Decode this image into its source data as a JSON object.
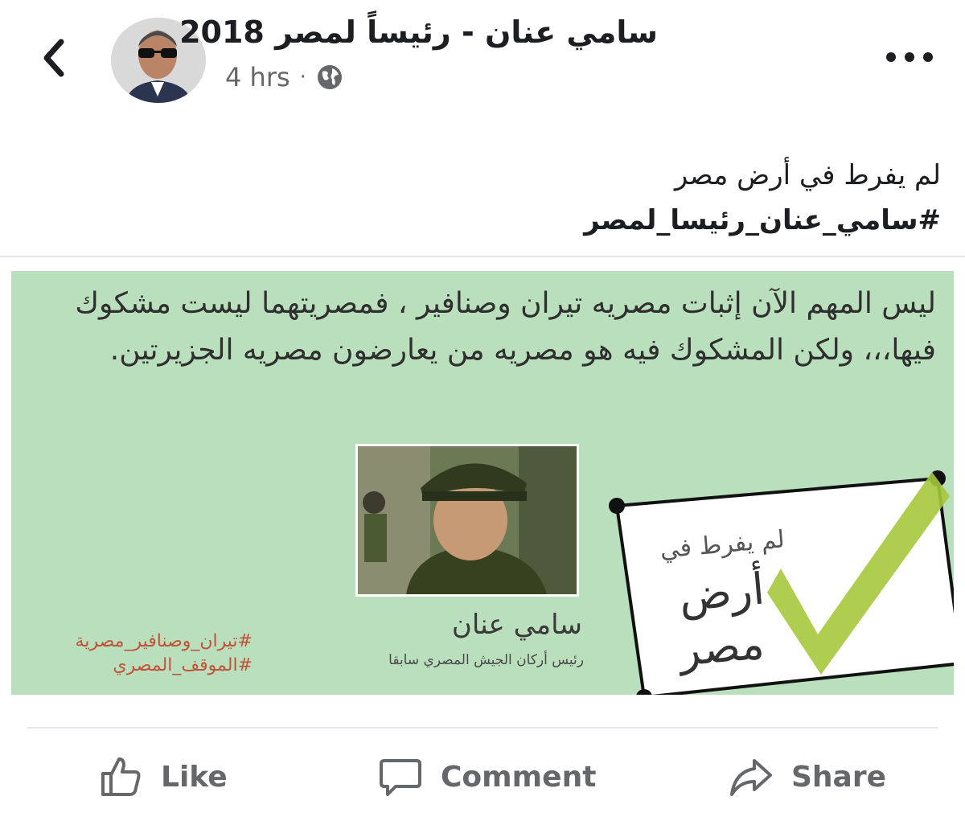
{
  "post": {
    "page_name": "سامي عنان - رئيساً لمصر 2018",
    "time": "4 hrs",
    "separator": "·",
    "caption_line1": "لم يفرط في أرض مصر",
    "caption_hashtag": "#سامي_عنان_رئيسا_لمصر"
  },
  "image": {
    "quote_line1": "ليس المهم الآن إثبات مصريه تيران وصنافير ، فمصريتهما ليست مشكوك",
    "quote_line2": "فيها،،، ولكن المشكوك فيه هو مصريه من يعارضون مصريه الجزيرتين.",
    "person_name": "سامي عنان",
    "person_title": "رئيس أركان الجيش المصري سابقا",
    "tag1": "#تيران_وصنافير_مصرية",
    "tag2": "#الموقف_المصري",
    "badge_line1": "لم يفرط في",
    "badge_line2": "أرض",
    "badge_line3": "مصر",
    "background_color": "#b9dfbc",
    "check_color": "#a6c83c"
  },
  "actions": {
    "like": "Like",
    "comment": "Comment",
    "share": "Share"
  },
  "icons": {
    "back": "chevron-left-icon",
    "audience": "globe-icon",
    "more": "more-dots-icon",
    "like": "thumbs-up-icon",
    "comment": "comment-bubble-icon",
    "share": "share-arrow-icon"
  }
}
